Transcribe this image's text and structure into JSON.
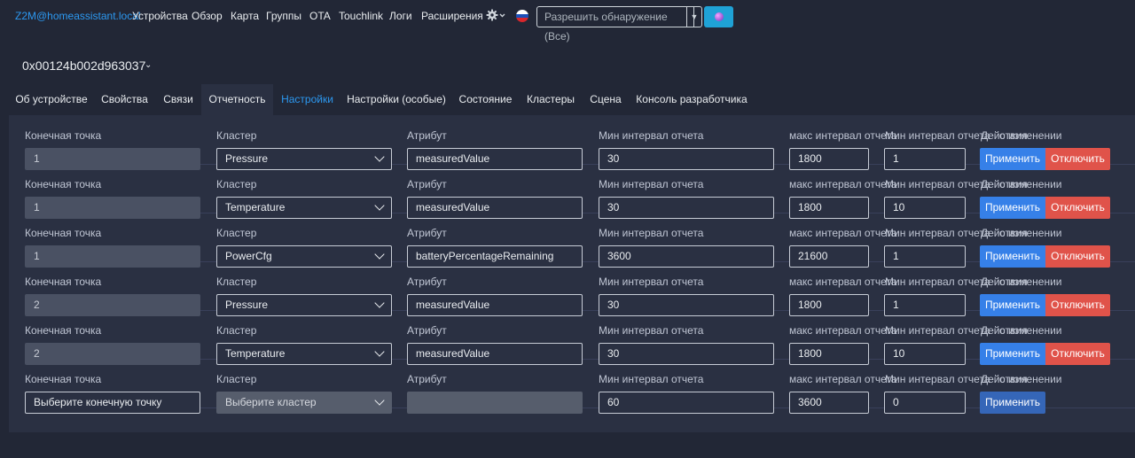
{
  "navbar": {
    "brand": "Z2M@homeassistant.local",
    "items": [
      "Устройства",
      "Обзор",
      "Карта",
      "Группы",
      "OTA",
      "Touchlink",
      "Логи",
      "Расширения"
    ],
    "settings_icon": "gear-icon",
    "language_icon": "flag-ru-icon",
    "permit_join_label": "Разрешить обнаружение (Все)",
    "permit_join_button_icon": "zigbee-icon"
  },
  "device": {
    "title": "0x00124b002d963037"
  },
  "tabs": {
    "items": [
      "Об устройстве",
      "Свойства",
      "Связи",
      "Отчетность",
      "Настройки",
      "Настройки (особые)",
      "Состояние",
      "Кластеры",
      "Сцена",
      "Консоль разработчика"
    ],
    "active": "Отчетность"
  },
  "reporting": {
    "labels": {
      "endpoint": "Конечная точка",
      "cluster": "Кластер",
      "attribute": "Атрибут",
      "min_interval": "Мин интервал отчета",
      "max_interval": "макс интервал отчета",
      "min_rep_change": "Мин интервал отчета",
      "actions": "Действия",
      "change_suffix": "о изменении"
    },
    "apply_label": "Применить",
    "disable_label": "Отключить",
    "rows": [
      {
        "endpoint": "1",
        "cluster": "Pressure",
        "attribute": "measuredValue",
        "min": "30",
        "max": "1800",
        "change": "1"
      },
      {
        "endpoint": "1",
        "cluster": "Temperature",
        "attribute": "measuredValue",
        "min": "30",
        "max": "1800",
        "change": "10"
      },
      {
        "endpoint": "1",
        "cluster": "PowerCfg",
        "attribute": "batteryPercentageRemaining",
        "min": "3600",
        "max": "21600",
        "change": "1"
      },
      {
        "endpoint": "2",
        "cluster": "Pressure",
        "attribute": "measuredValue",
        "min": "30",
        "max": "1800",
        "change": "1"
      },
      {
        "endpoint": "2",
        "cluster": "Temperature",
        "attribute": "measuredValue",
        "min": "30",
        "max": "1800",
        "change": "10"
      }
    ],
    "new_row": {
      "endpoint_placeholder": "Выберите конечную точку",
      "cluster_placeholder": "Выберите кластер",
      "attribute": "",
      "min": "60",
      "max": "3600",
      "change": "0"
    }
  },
  "colors": {
    "background": "#222736",
    "panel": "#2a3042",
    "link": "#2c98f0",
    "apply": "#3680e8",
    "disable": "#e0534a",
    "permit_button": "#1fa2d6"
  }
}
